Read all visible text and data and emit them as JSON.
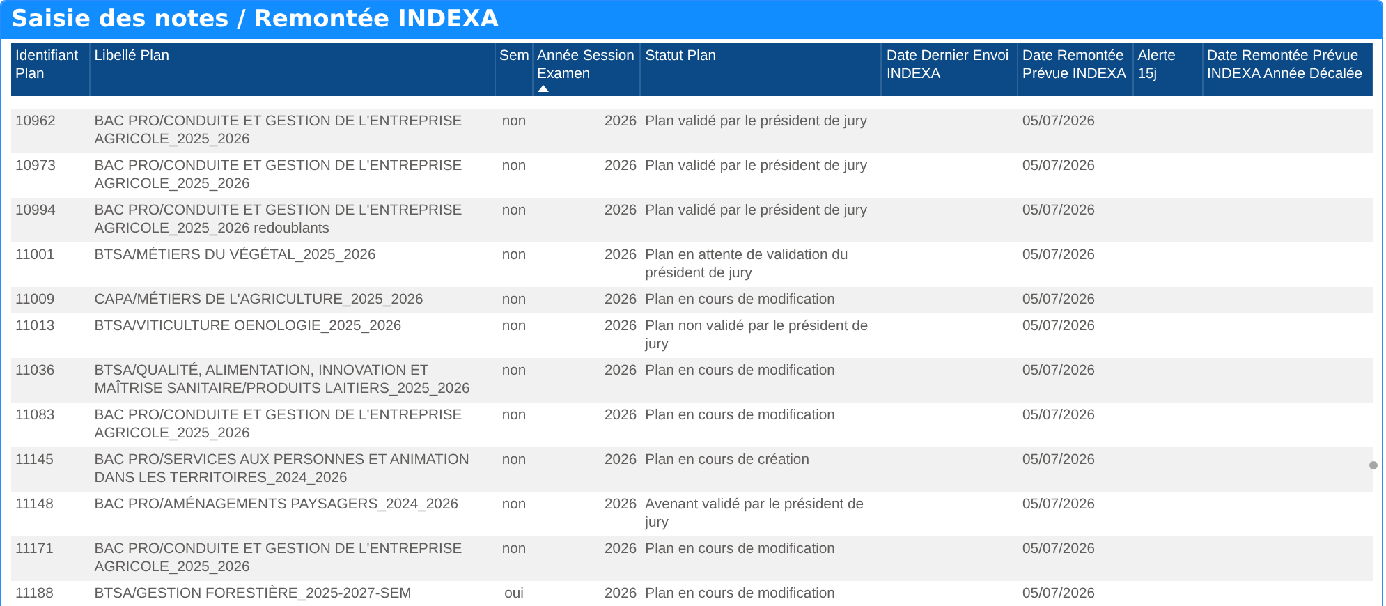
{
  "window": {
    "title": "Saisie des notes / Remontée INDEXA"
  },
  "table": {
    "columns": [
      {
        "label": "Identifiant Plan",
        "sorted": false
      },
      {
        "label": "Libellé Plan",
        "sorted": false
      },
      {
        "label": "Sem",
        "sorted": false
      },
      {
        "label": "Année Session Examen",
        "sorted": true
      },
      {
        "label": "Statut Plan",
        "sorted": false
      },
      {
        "label": "Date Dernier Envoi INDEXA",
        "sorted": false
      },
      {
        "label": "Date Remontée Prévue INDEXA",
        "sorted": false
      },
      {
        "label": "Alerte 15j",
        "sorted": false
      },
      {
        "label": "Date Remontée Prévue INDEXA Année Décalée",
        "sorted": false
      }
    ],
    "rows": [
      [
        "10962",
        "BAC PRO/CONDUITE ET GESTION DE L'ENTREPRISE AGRICOLE_2025_2026",
        "non",
        "2026",
        "Plan validé par le président de jury",
        "",
        "05/07/2026",
        "",
        ""
      ],
      [
        "10973",
        "BAC PRO/CONDUITE ET GESTION DE L'ENTREPRISE AGRICOLE_2025_2026",
        "non",
        "2026",
        "Plan validé par le président de jury",
        "",
        "05/07/2026",
        "",
        ""
      ],
      [
        "10994",
        "BAC PRO/CONDUITE ET GESTION DE L'ENTREPRISE AGRICOLE_2025_2026 redoublants",
        "non",
        "2026",
        "Plan validé par le président de jury",
        "",
        "05/07/2026",
        "",
        ""
      ],
      [
        "11001",
        "BTSA/MÉTIERS DU VÉGÉTAL_2025_2026",
        "non",
        "2026",
        "Plan en attente de validation du président de jury",
        "",
        "05/07/2026",
        "",
        ""
      ],
      [
        "11009",
        "CAPA/MÉTIERS DE L'AGRICULTURE_2025_2026",
        "non",
        "2026",
        "Plan en cours de modification",
        "",
        "05/07/2026",
        "",
        ""
      ],
      [
        "11013",
        "BTSA/VITICULTURE OENOLOGIE_2025_2026",
        "non",
        "2026",
        "Plan non validé par le président de jury",
        "",
        "05/07/2026",
        "",
        ""
      ],
      [
        "11036",
        "BTSA/QUALITÉ, ALIMENTATION, INNOVATION ET MAÎTRISE SANITAIRE/PRODUITS LAITIERS_2025_2026",
        "non",
        "2026",
        "Plan en cours de modification",
        "",
        "05/07/2026",
        "",
        ""
      ],
      [
        "11083",
        "BAC PRO/CONDUITE ET GESTION DE L'ENTREPRISE AGRICOLE_2025_2026",
        "non",
        "2026",
        "Plan en cours de modification",
        "",
        "05/07/2026",
        "",
        ""
      ],
      [
        "11145",
        "BAC PRO/SERVICES AUX PERSONNES ET ANIMATION DANS LES TERRITOIRES_2024_2026",
        "non",
        "2026",
        "Plan en cours de création",
        "",
        "05/07/2026",
        "",
        ""
      ],
      [
        "11148",
        "BAC PRO/AMÉNAGEMENTS PAYSAGERS_2024_2026",
        "non",
        "2026",
        "Avenant validé par le président de jury",
        "",
        "05/07/2026",
        "",
        ""
      ],
      [
        "11171",
        "BAC PRO/CONDUITE ET GESTION DE L'ENTREPRISE AGRICOLE_2025_2026",
        "non",
        "2026",
        "Plan en cours de modification",
        "",
        "05/07/2026",
        "",
        ""
      ],
      [
        "11188",
        "BTSA/GESTION FORESTIÈRE_2025-2027-SEM",
        "oui",
        "2026",
        "Plan en cours de modification",
        "",
        "05/07/2026",
        "",
        ""
      ]
    ]
  }
}
